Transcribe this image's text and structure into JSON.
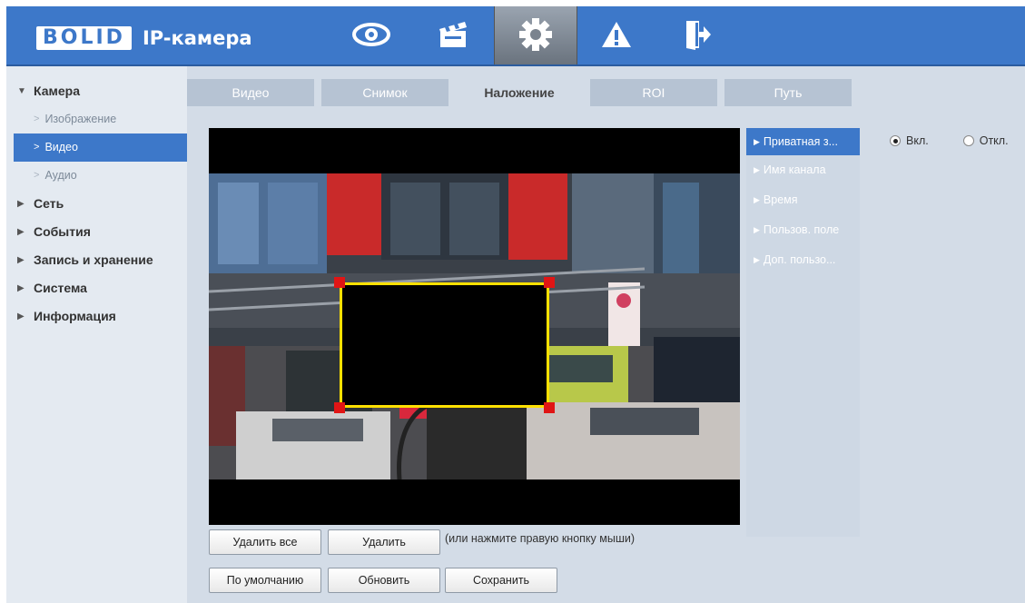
{
  "header": {
    "logo": "BOLID",
    "product": "IP-камера",
    "nav": [
      {
        "icon": "eye-icon",
        "active": false
      },
      {
        "icon": "clapperboard-icon",
        "active": false
      },
      {
        "icon": "gear-icon",
        "active": true
      },
      {
        "icon": "warning-icon",
        "active": false
      },
      {
        "icon": "exit-icon",
        "active": false
      }
    ],
    "colors": {
      "bar": "#3d78c9",
      "active": "#7a838e"
    }
  },
  "sidebar": {
    "camera": "Камера",
    "camera_sub": [
      "Изображение",
      "Видео",
      "Аудио"
    ],
    "active_sub": "Видео",
    "sections": [
      "Сеть",
      "События",
      "Запись и хранение",
      "Система",
      "Информация"
    ]
  },
  "tabs": [
    "Видео",
    "Снимок",
    "Наложение",
    "ROI",
    "Путь"
  ],
  "active_tab": "Наложение",
  "overlay_items": [
    "Приватная з...",
    "Имя канала",
    "Время",
    "Пользов. поле",
    "Доп. пользо..."
  ],
  "privacy": {
    "on": "Вкл.",
    "off": "Откл.",
    "selected": "on"
  },
  "buttons": {
    "delete_all": "Удалить все",
    "delete": "Удалить",
    "hint": "(или нажмите правую кнопку мыши)",
    "default": "По умолчанию",
    "refresh": "Обновить",
    "save": "Сохранить"
  }
}
